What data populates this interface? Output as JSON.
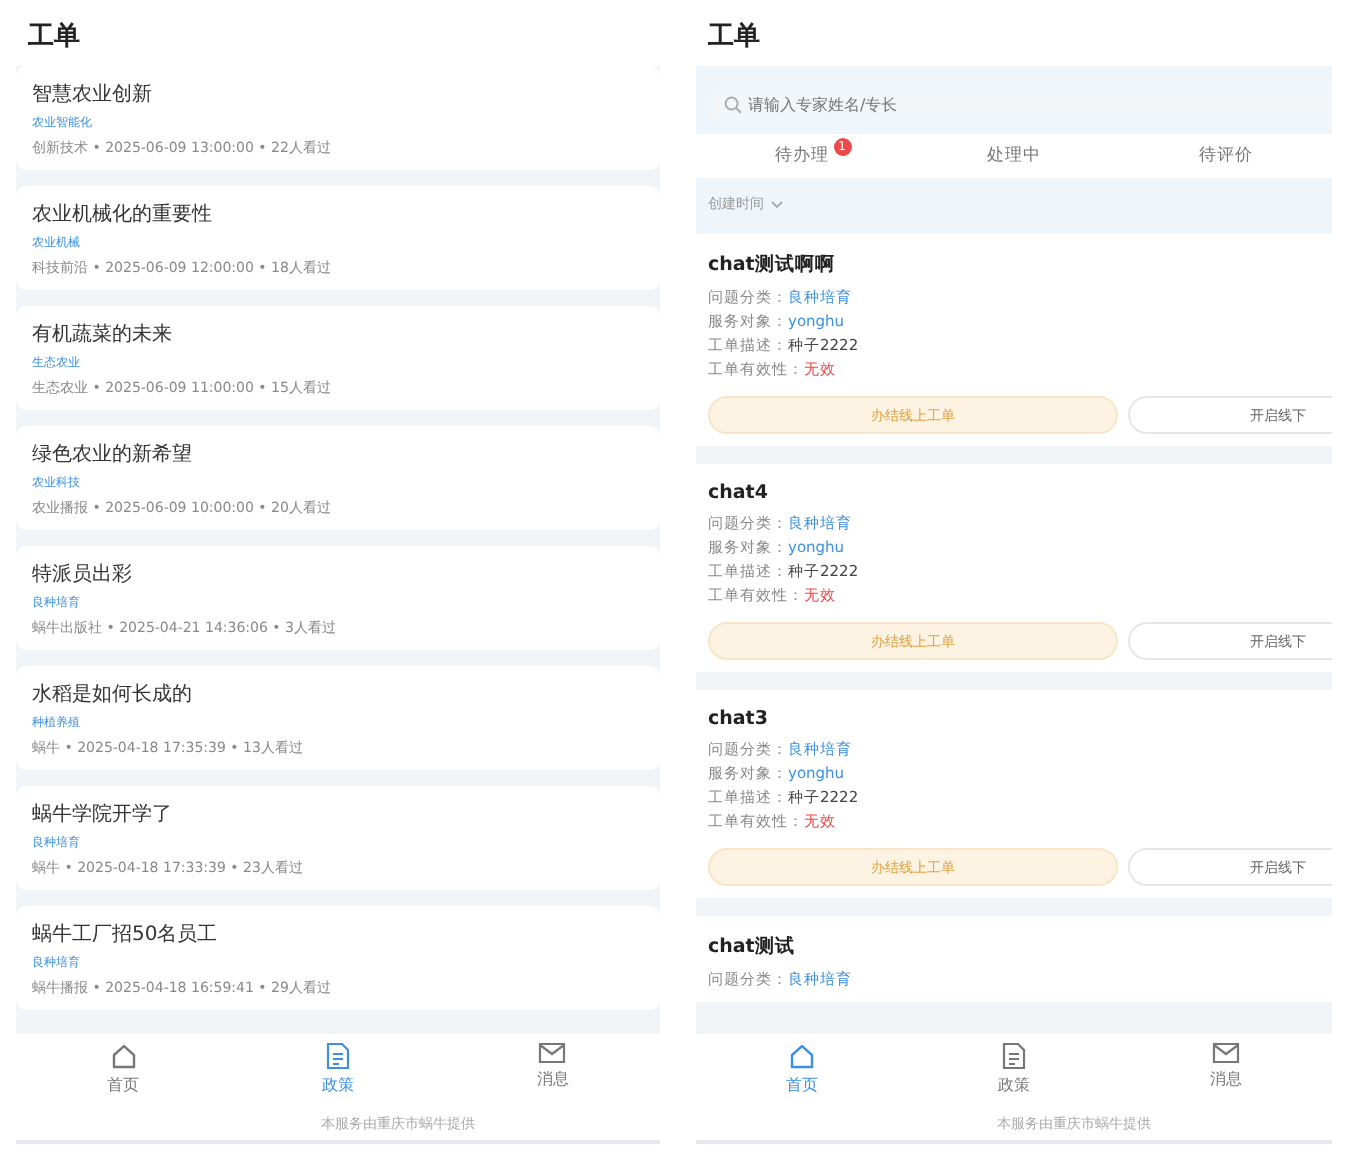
{
  "left_screen": {
    "title": "工单",
    "articles": [
      {
        "title": "智慧农业创新",
        "tag": "农业智能化",
        "meta": "创新技术 • 2025-06-09 13:00:00 • 22人看过"
      },
      {
        "title": "农业机械化的重要性",
        "tag": "农业机械",
        "meta": "科技前沿 • 2025-06-09 12:00:00 • 18人看过"
      },
      {
        "title": "有机蔬菜的未来",
        "tag": "生态农业",
        "meta": "生态农业 • 2025-06-09 11:00:00 • 15人看过"
      },
      {
        "title": "绿色农业的新希望",
        "tag": "农业科技",
        "meta": "农业播报 • 2025-06-09 10:00:00 • 20人看过"
      },
      {
        "title": "特派员出彩",
        "tag": "良种培育",
        "meta": "蜗牛出版社 • 2025-04-21 14:36:06 • 3人看过"
      },
      {
        "title": "水稻是如何长成的",
        "tag": "种植养殖",
        "meta": "蜗牛 • 2025-04-18 17:35:39 • 13人看过"
      },
      {
        "title": "蜗牛学院开学了",
        "tag": "良种培育",
        "meta": "蜗牛 • 2025-04-18 17:33:39 • 23人看过"
      },
      {
        "title": "蜗牛工厂招50名员工",
        "tag": "良种培育",
        "meta": "蜗牛播报 • 2025-04-18 16:59:41 • 29人看过"
      }
    ],
    "nav": [
      {
        "label": "首页",
        "kind": "home",
        "selected": false
      },
      {
        "label": "政策",
        "kind": "document",
        "selected": true
      },
      {
        "label": "消息",
        "kind": "mail",
        "selected": false
      }
    ],
    "footer": "本服务由重庆市蜗牛提供"
  },
  "right_screen": {
    "title": "工单",
    "search": {
      "placeholder": "请输入专家姓名/专长"
    },
    "tabs": [
      {
        "label": "待办理",
        "badge": "1",
        "selected": false
      },
      {
        "label": "处理中",
        "selected": false
      },
      {
        "label": "待评价",
        "selected": false
      }
    ],
    "sort": {
      "label": "创建时间"
    },
    "tickets": [
      {
        "title": "chat测试啊啊",
        "fields": [
          {
            "label": "问题分类：",
            "value": "良种培育",
            "kind": "link"
          },
          {
            "label": "服务对象：",
            "value": "yonghu",
            "kind": "link"
          },
          {
            "label": "工单描述：",
            "value": "种子2222",
            "kind": "plain"
          },
          {
            "label": "工单有效性：",
            "value": "无效",
            "kind": "danger"
          }
        ],
        "buttons": [
          {
            "label": "办结线上工单",
            "kind": "primary"
          },
          {
            "label": "开启线下",
            "kind": "outline"
          }
        ]
      },
      {
        "title": "chat4",
        "fields": [
          {
            "label": "问题分类：",
            "value": "良种培育",
            "kind": "link"
          },
          {
            "label": "服务对象：",
            "value": "yonghu",
            "kind": "link"
          },
          {
            "label": "工单描述：",
            "value": "种子2222",
            "kind": "plain"
          },
          {
            "label": "工单有效性：",
            "value": "无效",
            "kind": "danger"
          }
        ],
        "buttons": [
          {
            "label": "办结线上工单",
            "kind": "primary"
          },
          {
            "label": "开启线下",
            "kind": "outline"
          }
        ]
      },
      {
        "title": "chat3",
        "fields": [
          {
            "label": "问题分类：",
            "value": "良种培育",
            "kind": "link"
          },
          {
            "label": "服务对象：",
            "value": "yonghu",
            "kind": "link"
          },
          {
            "label": "工单描述：",
            "value": "种子2222",
            "kind": "plain"
          },
          {
            "label": "工单有效性：",
            "value": "无效",
            "kind": "danger"
          }
        ],
        "buttons": [
          {
            "label": "办结线上工单",
            "kind": "primary"
          },
          {
            "label": "开启线下",
            "kind": "outline"
          }
        ]
      },
      {
        "title": "chat测试",
        "fields": [
          {
            "label": "问题分类：",
            "value": "良种培育",
            "kind": "link"
          }
        ]
      }
    ],
    "nav": [
      {
        "label": "首页",
        "kind": "home",
        "selected": true
      },
      {
        "label": "政策",
        "kind": "document",
        "selected": false
      },
      {
        "label": "消息",
        "kind": "mail",
        "selected": false
      }
    ],
    "footer": "本服务由重庆市蜗牛提供"
  }
}
